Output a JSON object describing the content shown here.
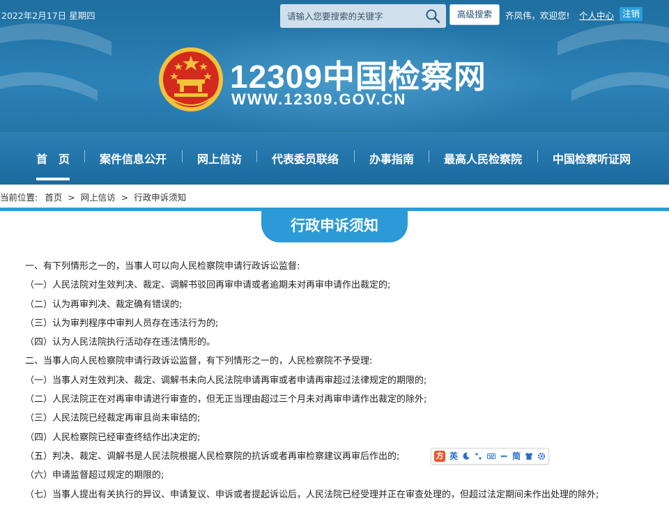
{
  "header": {
    "date": "2022年2月17日 星期四",
    "search": {
      "placeholder": "请输入您要搜索的关键字"
    },
    "advanced_search_label": "高级搜索",
    "welcome_text": "齐凤伟，欢迎您!",
    "personal_center_label": "个人中心",
    "logout_label": "注销",
    "brand_title": "12309中国检察网",
    "brand_url": "WWW.12309.GOV.CN"
  },
  "nav": {
    "items": [
      {
        "label": "首　页",
        "active": true
      },
      {
        "label": "案件信息公开"
      },
      {
        "label": "网上信访"
      },
      {
        "label": "代表委员联络"
      },
      {
        "label": "办事指南"
      },
      {
        "label": "最高人民检察院"
      },
      {
        "label": "中国检察听证网"
      }
    ]
  },
  "breadcrumb": {
    "prefix": "当前位置:",
    "items": [
      "首页",
      "网上信访",
      "行政申诉须知"
    ],
    "separator": ">"
  },
  "page_title": "行政申诉须知",
  "content": {
    "lines": [
      "一、有下列情形之一的，当事人可以向人民检察院申请行政诉讼监督:",
      "（一）人民法院对生效判决、裁定、调解书驳回再审申请或者逾期未对再审申请作出裁定的;",
      "（二）认为再审判决、裁定确有错误的;",
      "（三）认为审判程序中审判人员存在违法行为的;",
      "（四）认为人民法院执行活动存在违法情形的。",
      "二、当事人向人民检察院申请行政诉讼监督，有下列情形之一的，人民检察院不予受理:",
      "（一）当事人对生效判决、裁定、调解书未向人民法院申请再审或者申请再审超过法律规定的期限的;",
      "（二）人民法院正在对再审申请进行审查的，但无正当理由超过三个月未对再审申请作出裁定的除外;",
      "（三）人民法院已经裁定再审且尚未审结的;",
      "（四）人民检察院已经审查终结作出决定的;",
      "（五）判决、裁定、调解书是人民法院根据人民检察院的抗诉或者再审检察建议再审后作出的;",
      "（六）申请监督超过规定的期限的;",
      "（七）当事人提出有关执行的异议、申请复议、申诉或者提起诉讼后，人民法院已经受理并正在审查处理的，但超过法定期间未作出处理的除外;"
    ]
  },
  "ime": {
    "logo": "方",
    "lang_label": "英",
    "simplified_label": "简"
  },
  "colors": {
    "header_blue": "#1f6fa0",
    "accent_blue": "#2c9ad6",
    "logout_blue": "#2a9fd9",
    "emblem_red": "#d42a1e",
    "emblem_gold": "#f3c33b"
  }
}
